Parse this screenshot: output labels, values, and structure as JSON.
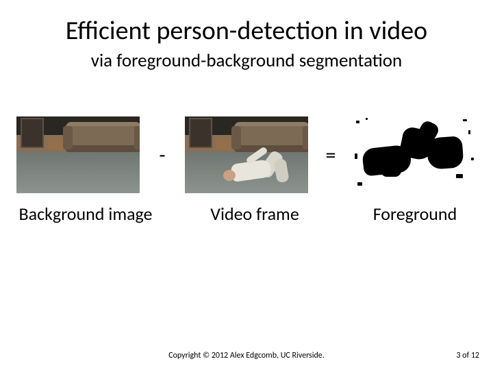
{
  "title": "Efficient person-detection in video",
  "subtitle": "via foreground-background segmentation",
  "op_minus": "-",
  "op_equals": "=",
  "captions": {
    "background": "Background image",
    "frame": "Video frame",
    "foreground": "Foreground"
  },
  "footer": {
    "copyright": "Copyright © 2012 Alex Edgcomb, UC Riverside.",
    "page": "3 of 12"
  }
}
